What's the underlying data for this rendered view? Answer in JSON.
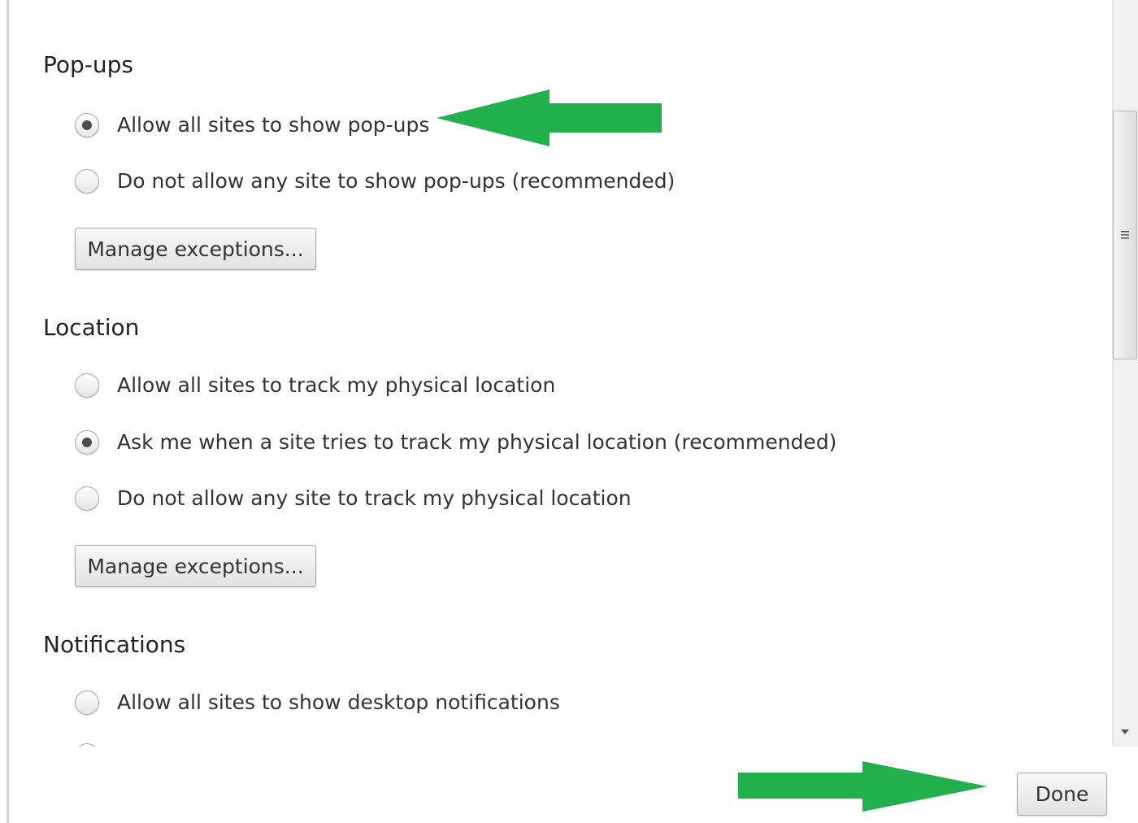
{
  "sections": {
    "popups": {
      "title": "Pop-ups",
      "options": [
        {
          "label": "Allow all sites to show pop-ups",
          "checked": true
        },
        {
          "label": "Do not allow any site to show pop-ups (recommended)",
          "checked": false
        }
      ],
      "manage_label": "Manage exceptions..."
    },
    "location": {
      "title": "Location",
      "options": [
        {
          "label": "Allow all sites to track my physical location",
          "checked": false
        },
        {
          "label": "Ask me when a site tries to track my physical location (recommended)",
          "checked": true
        },
        {
          "label": "Do not allow any site to track my physical location",
          "checked": false
        }
      ],
      "manage_label": "Manage exceptions..."
    },
    "notifications": {
      "title": "Notifications",
      "options": [
        {
          "label": "Allow all sites to show desktop notifications",
          "checked": false
        }
      ]
    }
  },
  "footer": {
    "done_label": "Done"
  },
  "colors": {
    "annotation_arrow": "#21b04b",
    "radio_dot": "#4d4d4d"
  },
  "icons": {
    "scroll_grip": "scrollbar-grip-icon",
    "scroll_down": "scroll-down-arrow-icon",
    "annotation": "green-arrow-icon"
  }
}
